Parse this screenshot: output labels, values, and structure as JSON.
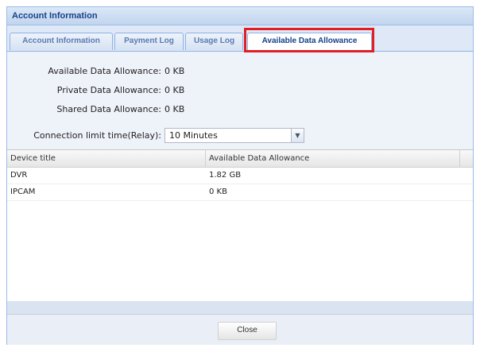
{
  "window": {
    "title": "Account Information"
  },
  "tabs": [
    {
      "label": "Account Information",
      "active": false
    },
    {
      "label": "Payment Log",
      "active": false
    },
    {
      "label": "Usage Log",
      "active": false
    },
    {
      "label": "Available Data Allowance",
      "active": true
    }
  ],
  "allowance": {
    "available_label": "Available Data Allowance:",
    "available_value": "0 KB",
    "private_label": "Private Data Allowance:",
    "private_value": "0 KB",
    "shared_label": "Shared Data Allowance:",
    "shared_value": "0 KB"
  },
  "connection": {
    "label": "Connection limit time(Relay):",
    "selected": "10 Minutes"
  },
  "grid": {
    "columns": [
      "Device title",
      "Available Data Allowance"
    ],
    "rows": [
      [
        "DVR",
        "1.82 GB"
      ],
      [
        "IPCAM",
        "0 KB"
      ]
    ]
  },
  "footer": {
    "close_label": "Close"
  },
  "colors": {
    "highlight": "#e01e26",
    "title_text": "#15428b"
  },
  "icons": {
    "dropdown": "chevron-down-icon"
  }
}
